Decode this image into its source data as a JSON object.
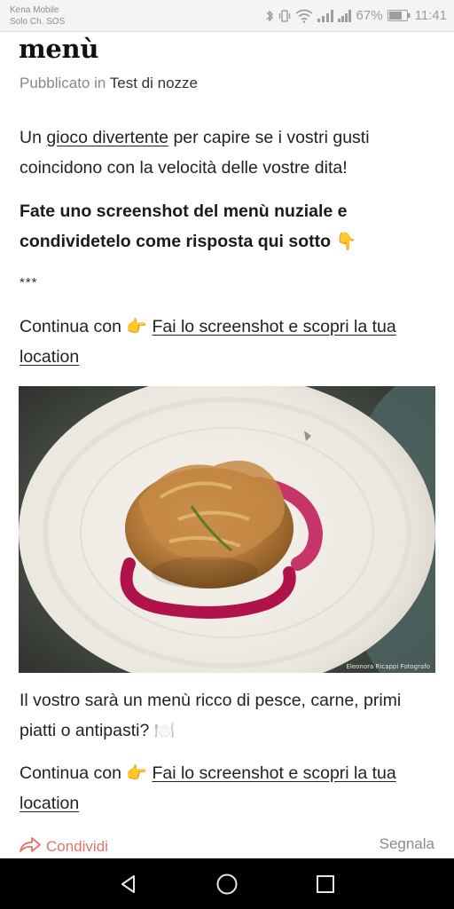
{
  "status_bar": {
    "carrier_line1": "Kena Mobile",
    "carrier_line2": "Solo Ch. SOS",
    "battery": "67%",
    "time": "11:41"
  },
  "post": {
    "title": "menù",
    "published_in_label": "Pubblicato in",
    "category": "Test di nozze",
    "intro_prefix": "Un ",
    "intro_link": "gioco divertente",
    "intro_suffix": " per capire se i vostri gusti coincidono con la velocità delle vostre dita!",
    "bold_text": "Fate uno screenshot del menù nuziale e condividetelo come risposta qui sotto",
    "bold_emoji": "👇",
    "separator": "***",
    "continue_prefix": "Continua con ",
    "continue_emoji": "👉",
    "continue_link": "Fai lo screenshot e scopri la tua location",
    "photo_credit": "Eleonora Ricappi Fotografo",
    "body_text": "Il vostro sarà un menù ricco di pesce, carne, primi piatti o antipasti?",
    "body_emoji": "🍽️"
  },
  "actions": {
    "share_label": "Condividi",
    "report_label": "Segnala"
  },
  "colors": {
    "accent": "#e2756a",
    "plate": "#f2efe9",
    "sauce": "#b0124a"
  }
}
